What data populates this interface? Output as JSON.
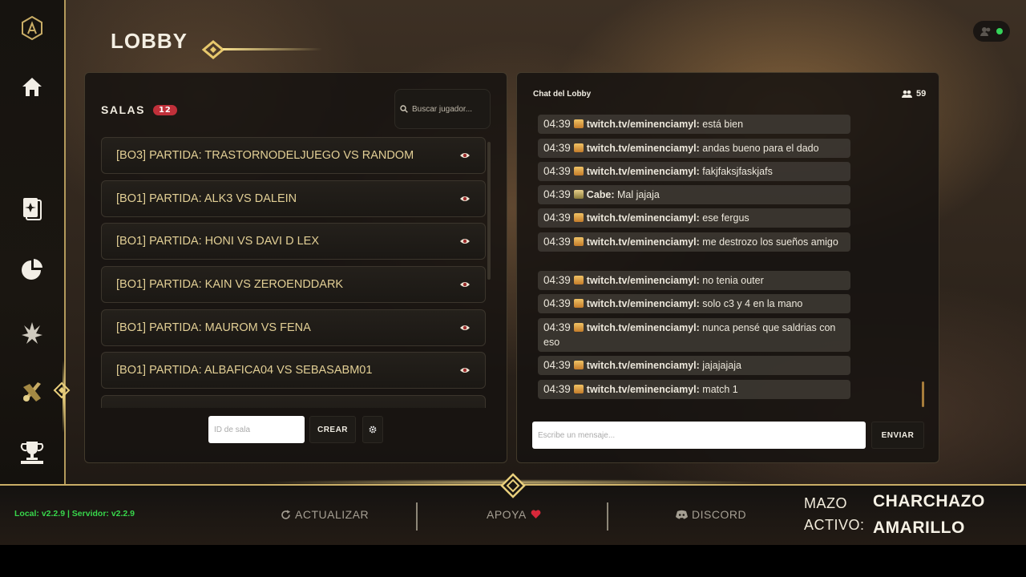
{
  "page": {
    "title": "LOBBY"
  },
  "rooms": {
    "title": "SALAS",
    "count": "12",
    "search_placeholder": "Buscar jugador...",
    "items": [
      {
        "label": "[BO3] PARTIDA: TRASTORNODELJUEGO VS RANDOM"
      },
      {
        "label": "[BO1] PARTIDA: ALK3 VS DALEIN"
      },
      {
        "label": "[BO1] PARTIDA: HONI VS DAVI D LEX"
      },
      {
        "label": "[BO1] PARTIDA: KAIN VS ZEROENDDARK"
      },
      {
        "label": "[BO1] PARTIDA: MAUROM VS FENA"
      },
      {
        "label": "[BO1] PARTIDA: ALBAFICA04 VS SEBASABM01"
      },
      {
        "label": ""
      }
    ],
    "room_id_placeholder": "ID de sala",
    "create_label": "CREAR"
  },
  "chat": {
    "title": "Chat del Lobby",
    "online_count": "59",
    "messages": [
      {
        "time": "04:39",
        "user": "twitch.tv/eminenciamyl:",
        "text": "está bien"
      },
      {
        "time": "04:39",
        "user": "twitch.tv/eminenciamyl:",
        "text": "andas bueno para el dado"
      },
      {
        "time": "04:39",
        "user": "twitch.tv/eminenciamyl:",
        "text": "fakjfaksjfaskjafs"
      },
      {
        "time": "04:39",
        "user": "Cabe:",
        "text": "Mal jajaja"
      },
      {
        "time": "04:39",
        "user": "twitch.tv/eminenciamyl:",
        "text": "ese fergus"
      },
      {
        "time": "04:39",
        "user": "twitch.tv/eminenciamyl:",
        "text": "me destrozo los sueños amigo"
      },
      {
        "time": "04:39",
        "user": "twitch.tv/eminenciamyl:",
        "text": "no tenia outer"
      },
      {
        "time": "04:39",
        "user": "twitch.tv/eminenciamyl:",
        "text": "solo c3 y 4 en la mano"
      },
      {
        "time": "04:39",
        "user": "twitch.tv/eminenciamyl:",
        "text": "nunca pensé que saldrias con eso"
      },
      {
        "time": "04:39",
        "user": "twitch.tv/eminenciamyl:",
        "text": "jajajajaja"
      },
      {
        "time": "04:39",
        "user": "twitch.tv/eminenciamyl:",
        "text": "match 1"
      }
    ],
    "input_placeholder": "Escribe un mensaje...",
    "send_label": "ENVIAR"
  },
  "footer": {
    "version": "Local: v2.2.9 | Servidor: v2.2.9",
    "refresh_label": "ACTUALIZAR",
    "support_label": "APOYA",
    "discord_label": "DISCORD",
    "deck_label_1": "MAZO",
    "deck_label_2": "ACTIVO:",
    "deck_value_1": "CHARCHAZO",
    "deck_value_2": "AMARILLO"
  },
  "colors": {
    "accent_gold": "#c9ad66",
    "room_text": "#e2cf95",
    "badge_red": "#c0303a",
    "online_green": "#35d35a",
    "version_green": "#38d64b"
  },
  "icons": {
    "sidebar": [
      "logo-icon",
      "home-icon",
      "cards-icon",
      "stats-pie-icon",
      "faction-icon",
      "battle-icon",
      "trophy-icon"
    ]
  }
}
